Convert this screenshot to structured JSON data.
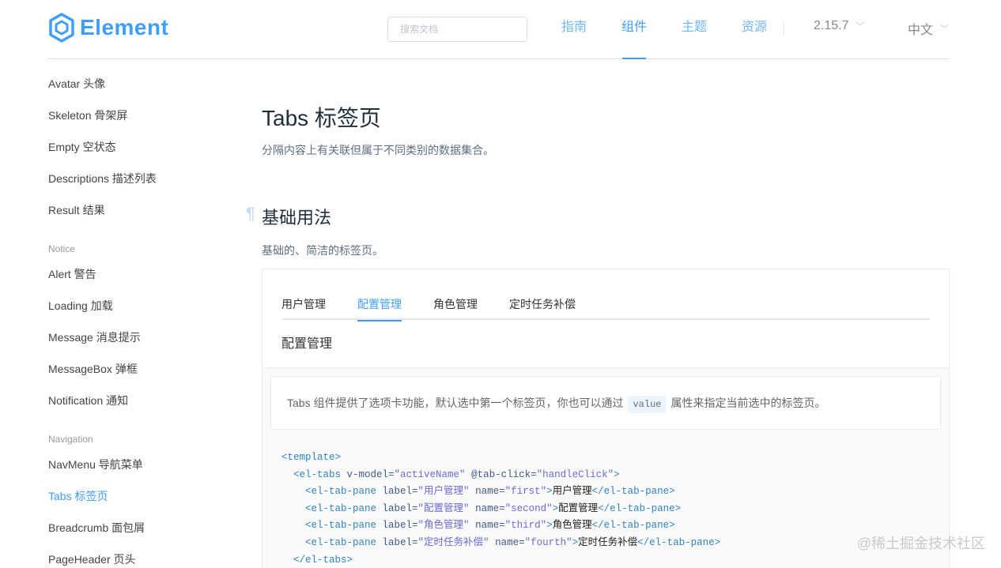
{
  "header": {
    "logo_text": "Element",
    "search_placeholder": "搜索文档",
    "nav": [
      "指南",
      "组件",
      "主题",
      "资源"
    ],
    "nav_active_index": 1,
    "version": "2.15.7",
    "language": "中文",
    "brand_color": "#409eff"
  },
  "sidebar": {
    "items_top": [
      "Avatar 头像",
      "Skeleton 骨架屏",
      "Empty 空状态",
      "Descriptions 描述列表",
      "Result 结果"
    ],
    "group_notice": "Notice",
    "items_notice": [
      "Alert 警告",
      "Loading 加载",
      "Message 消息提示",
      "MessageBox 弹框",
      "Notification 通知"
    ],
    "group_navigation": "Navigation",
    "items_navigation": [
      "NavMenu 导航菜单",
      "Tabs 标签页",
      "Breadcrumb 面包屑",
      "PageHeader 页头"
    ],
    "active_item": "Tabs 标签页"
  },
  "main": {
    "title": "Tabs 标签页",
    "description": "分隔内容上有关联但属于不同类别的数据集合。",
    "anchor": "¶",
    "section_title": "基础用法",
    "section_desc": "基础的、简洁的标签页。",
    "demo": {
      "tabs": [
        "用户管理",
        "配置管理",
        "角色管理",
        "定时任务补偿"
      ],
      "active_tab_index": 1,
      "pane_content": "配置管理"
    },
    "meta_desc_before": "Tabs 组件提供了选项卡功能，默认选中第一个标签页，你也可以通过",
    "meta_desc_code": "value",
    "meta_desc_after": "属性来指定当前选中的标签页。",
    "code": {
      "l1_tag": "<template>",
      "l2_open": "<el-tabs",
      "l2_attr1": " v-model=",
      "l2_val1": "\"activeName\"",
      "l2_attr2": " @tab-click=",
      "l2_val2": "\"handleClick\"",
      "l2_close": ">",
      "panes": [
        {
          "label": "\"用户管理\"",
          "name": "\"first\"",
          "text": "用户管理"
        },
        {
          "label": "\"配置管理\"",
          "name": "\"second\"",
          "text": "配置管理"
        },
        {
          "label": "\"角色管理\"",
          "name": "\"third\"",
          "text": "角色管理"
        },
        {
          "label": "\"定时任务补偿\"",
          "name": "\"fourth\"",
          "text": "定时任务补偿"
        }
      ],
      "pane_open": "<el-tab-pane",
      "pane_label_attr": " label=",
      "pane_name_attr": " name=",
      "pane_gt": ">",
      "pane_close": "</el-tab-pane>",
      "last_line": "</el-tabs>"
    }
  },
  "watermark": "@稀土掘金技术社区"
}
